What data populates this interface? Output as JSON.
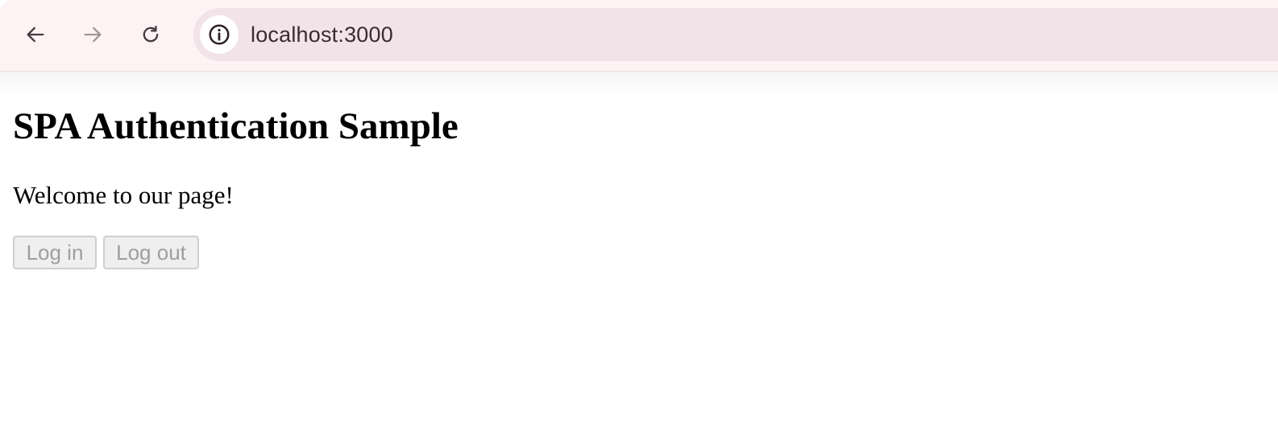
{
  "browser": {
    "url": "localhost:3000",
    "icons": {
      "back": "arrow-left-icon",
      "forward": "arrow-right-icon",
      "reload": "reload-icon",
      "site_info": "info-icon"
    },
    "colors": {
      "toolbar_bg": "#fdf3f4",
      "omnibox_bg": "#f1e3e8",
      "icon_active": "#4a3a3f",
      "icon_disabled": "#a39498"
    }
  },
  "page": {
    "title": "SPA Authentication Sample",
    "welcome_text": "Welcome to our page!",
    "buttons": {
      "login_label": "Log in",
      "logout_label": "Log out"
    },
    "colors": {
      "disabled_button_text": "#9e9e9e"
    }
  }
}
